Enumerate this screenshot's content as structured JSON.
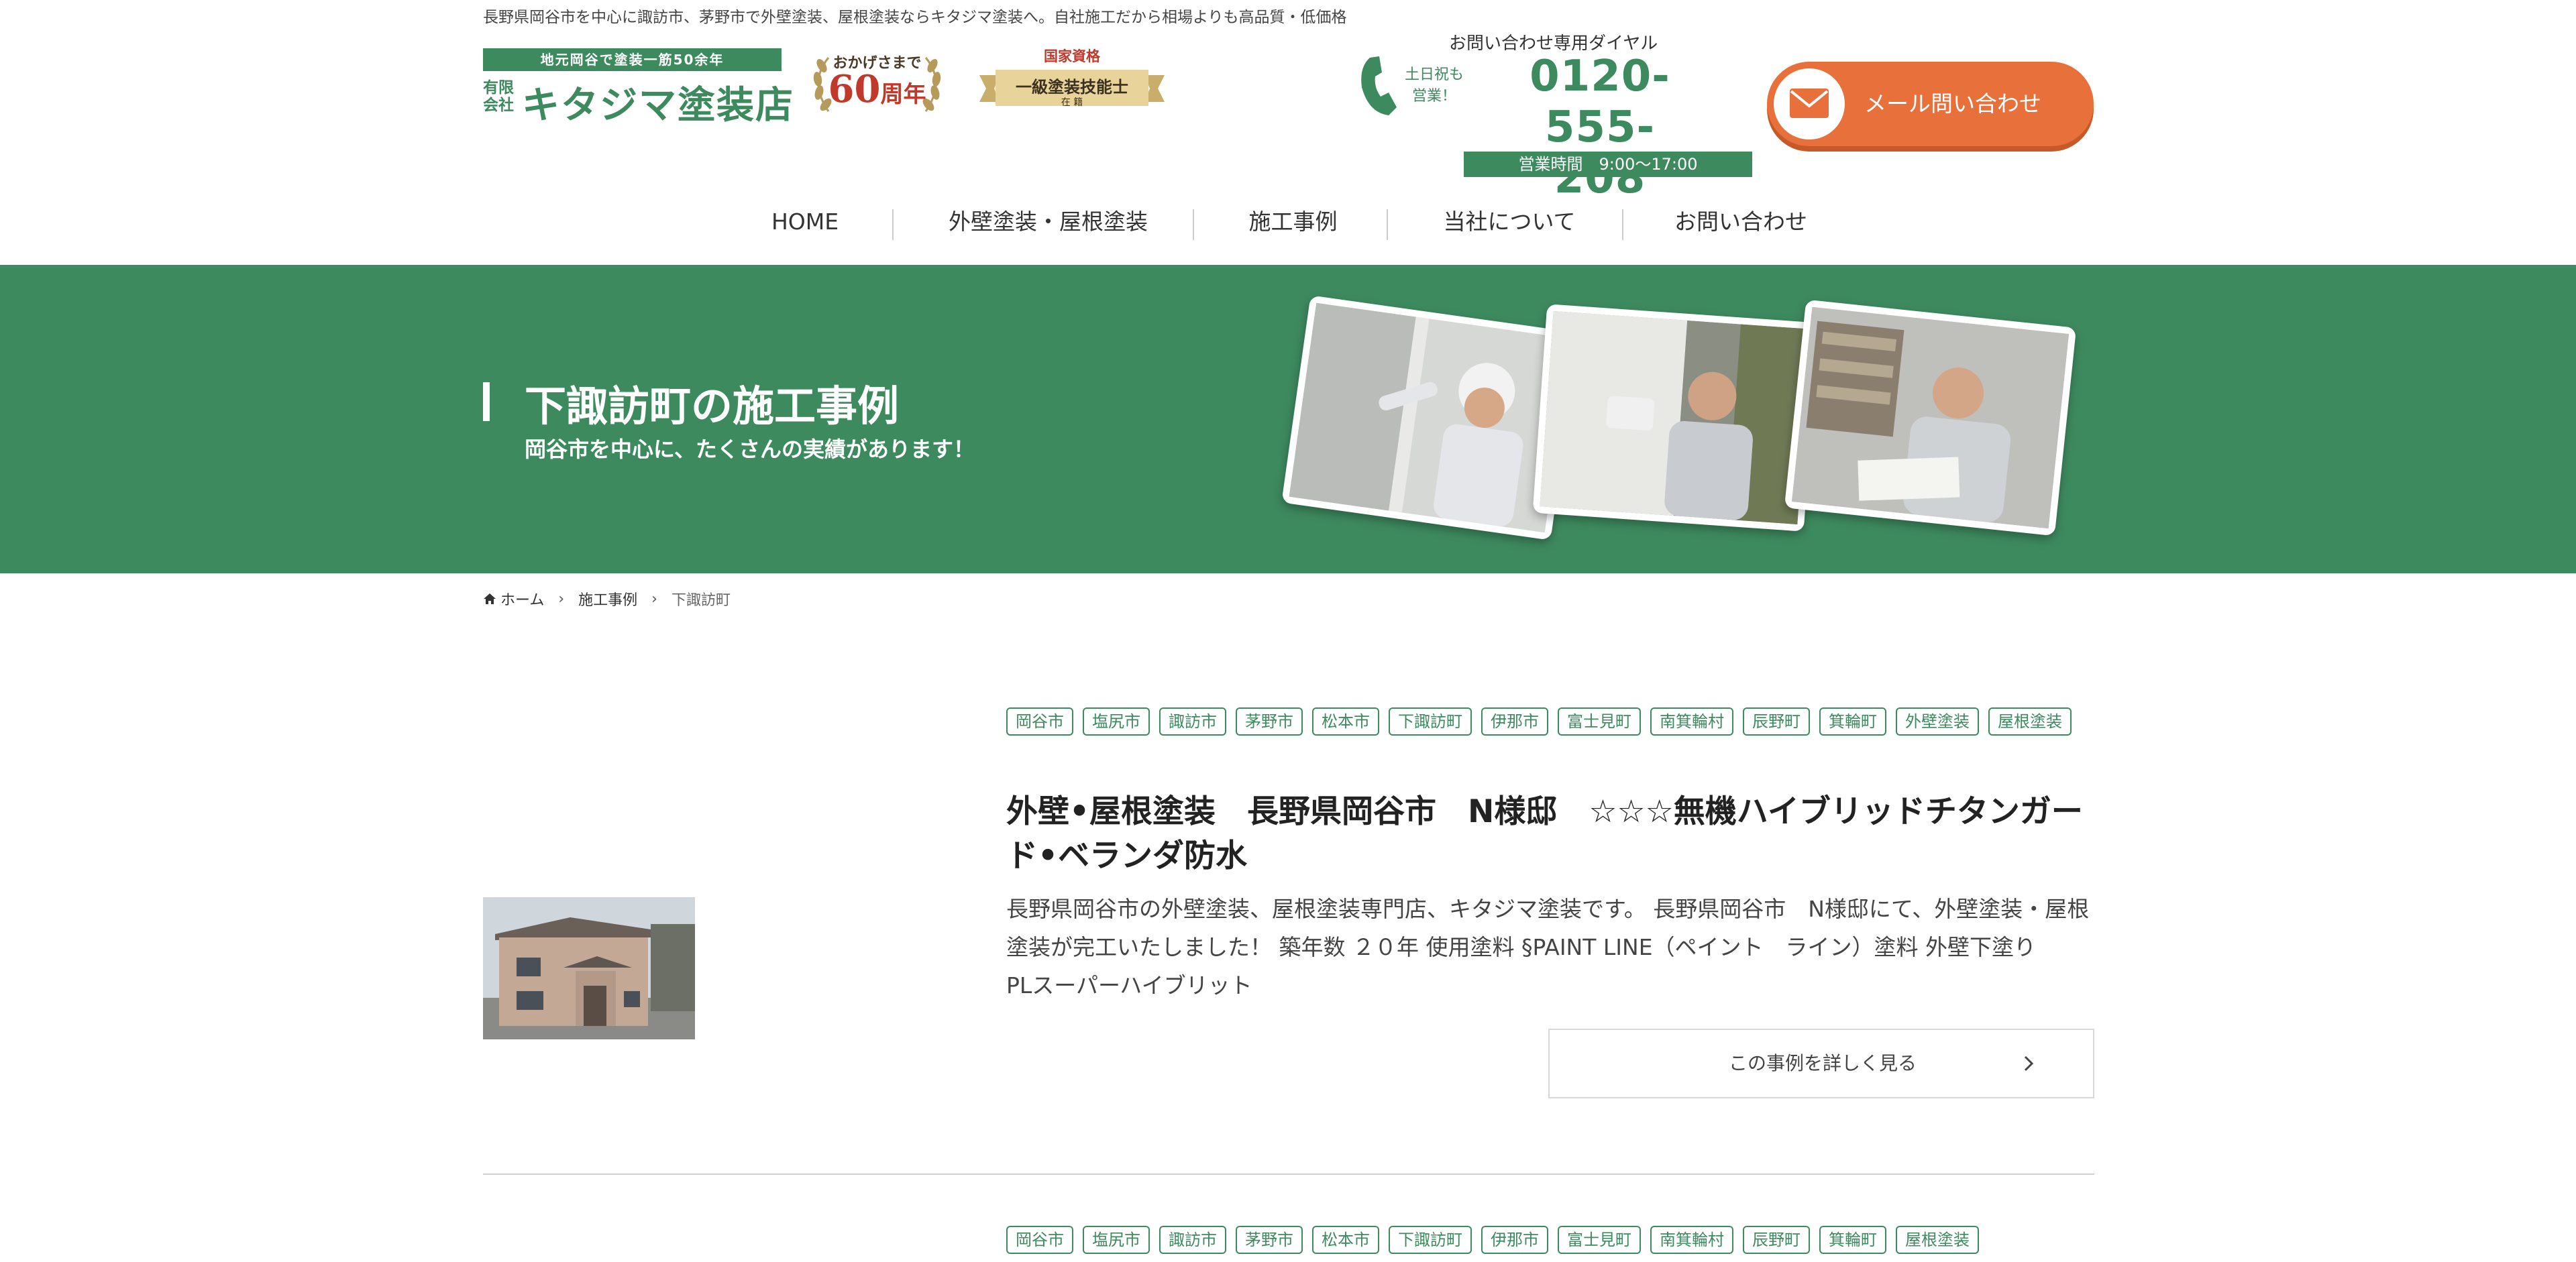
{
  "header": {
    "tagline": "長野県岡谷市を中心に諏訪市、茅野市で外壁塗装、屋根塗装ならキタジマ塗装へ。自社施工だから相場よりも高品質・低価格",
    "logo": {
      "sub": "地元岡谷で塗装一筋50余年",
      "kind_line1": "有限",
      "kind_line2": "会社",
      "name": "キタジマ塗装店"
    },
    "badge_anniversary": {
      "top": "おかげさまで",
      "number": "60",
      "unit": "周年"
    },
    "badge_license": {
      "top": "国家資格",
      "main": "一級塗装技能士",
      "sub": "在 籍"
    },
    "contact": {
      "dial_label": "お問い合わせ専用ダイヤル",
      "weekend_line1": "土日祝も",
      "weekend_line2": "営業！",
      "phone_line1": "0120-555-",
      "phone_line2": "208",
      "hours": "営業時間　9:00〜17:00"
    },
    "mail_button": "メール問い合わせ"
  },
  "nav": [
    {
      "label": "HOME"
    },
    {
      "label": "外壁塗装・屋根塗装"
    },
    {
      "label": "施工事例"
    },
    {
      "label": "当社について"
    },
    {
      "label": "お問い合わせ"
    }
  ],
  "hero": {
    "title": "下諏訪町の施工事例",
    "subtitle": "岡谷市を中心に、たくさんの実績があります！"
  },
  "breadcrumb": {
    "home": "ホーム",
    "items": [
      "施工事例",
      "下諏訪町"
    ]
  },
  "cases": [
    {
      "tags": [
        "岡谷市",
        "塩尻市",
        "諏訪市",
        "茅野市",
        "松本市",
        "下諏訪町",
        "伊那市",
        "富士見町",
        "南箕輪村",
        "辰野町",
        "箕輪町",
        "外壁塗装",
        "屋根塗装"
      ],
      "title": "外壁•屋根塗装　長野県岡谷市　N様邸　☆☆☆無機ハイブリッドチタンガード•ベランダ防水",
      "excerpt": "長野県岡谷市の外壁塗装、屋根塗装専門店、キタジマ塗装です。 長野県岡谷市　N様邸にて、外壁塗装・屋根塗装が完工いたしました！ 築年数 ２０年 使用塗料 §PAINT LINE（ペイント　ライン）塗料 外壁下塗り　　PLスーパーハイブリット",
      "button": "この事例を詳しく見る"
    },
    {
      "tags": [
        "岡谷市",
        "塩尻市",
        "諏訪市",
        "茅野市",
        "松本市",
        "下諏訪町",
        "伊那市",
        "富士見町",
        "南箕輪村",
        "辰野町",
        "箕輪町",
        "屋根塗装"
      ]
    }
  ],
  "colors": {
    "brand_green": "#3e8a5f",
    "accent_orange": "#e8703a",
    "text": "#333333"
  }
}
